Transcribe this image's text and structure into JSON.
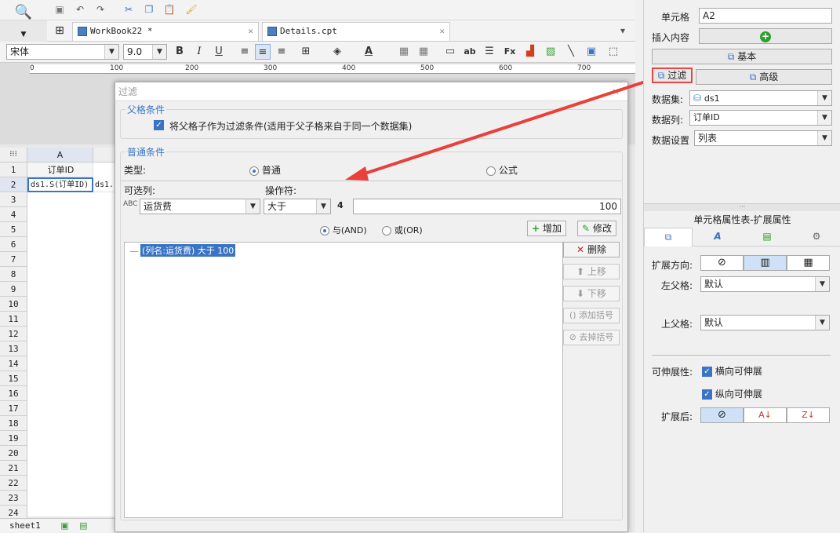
{
  "tabs": [
    {
      "label": "WorkBook22 *"
    },
    {
      "label": "Details.cpt"
    }
  ],
  "font": {
    "name": "宋体",
    "size": "9.0"
  },
  "ruler": [
    "0",
    "100",
    "200",
    "300",
    "400",
    "500",
    "600",
    "700"
  ],
  "grid": {
    "column_a": "A",
    "rows": [
      "1",
      "2",
      "3",
      "4",
      "5",
      "6",
      "7",
      "8",
      "9",
      "10",
      "11",
      "12",
      "13",
      "14",
      "15",
      "16",
      "17",
      "18",
      "19",
      "20",
      "21",
      "22",
      "23",
      "24"
    ],
    "a1": "订单ID",
    "a2": "ds1.S(订单ID)",
    "b2": "ds1.",
    "sheet": "sheet1"
  },
  "dialog": {
    "title": "过滤",
    "parent_group": "父格条件",
    "parent_checkbox": "将父格子作为过滤条件(适用于父子格来自于同一个数据集)",
    "normal_group": "普通条件",
    "type_label": "类型:",
    "type_normal": "普通",
    "type_formula": "公式",
    "column_label": "可选列:",
    "operator_label": "操作符:",
    "column_value": "运货费",
    "operator_value": "大于",
    "value_type": "4",
    "value": "100",
    "and_label": "与(AND)",
    "or_label": "或(OR)",
    "add_label": "增加",
    "modify_label": "修改",
    "condition_item": "(列名:运货费) 大于 100",
    "delete_label": "删除",
    "up_label": "上移",
    "down_label": "下移",
    "add_bracket": "添加括号",
    "remove_bracket": "去掉括号"
  },
  "right": {
    "cell_label": "单元格",
    "cell_value": "A2",
    "insert_label": "插入内容",
    "basic_btn": "基本",
    "filter_btn": "过滤",
    "advanced_btn": "高级",
    "dataset_label": "数据集:",
    "dataset_value": "ds1",
    "column_label": "数据列:",
    "column_value": "订单ID",
    "setting_label": "数据设置",
    "setting_value": "列表",
    "props_title": "单元格属性表-扩展属性",
    "expand_dir": "扩展方向:",
    "left_parent": "左父格:",
    "left_parent_value": "默认",
    "top_parent": "上父格:",
    "top_parent_value": "默认",
    "stretch": "可伸展性:",
    "h_stretch": "横向可伸展",
    "v_stretch": "纵向可伸展",
    "after_expand": "扩展后:"
  }
}
